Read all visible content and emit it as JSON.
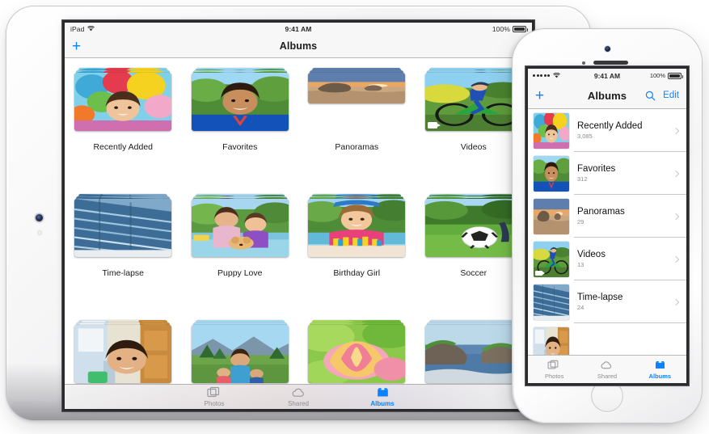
{
  "ipad": {
    "status": {
      "carrier": "iPad",
      "wifi_icon": "wifi-icon",
      "time": "9:41 AM",
      "battery": "100%"
    },
    "nav": {
      "add_label": "+",
      "title": "Albums"
    },
    "albums": [
      {
        "label": "Recently Added",
        "image": "girl-with-balloons"
      },
      {
        "label": "Favorites",
        "image": "boy-in-blue-shirt"
      },
      {
        "label": "Panoramas",
        "image": "sea-stack-panorama",
        "wide": true
      },
      {
        "label": "Videos",
        "image": "mountain-biker",
        "video": true
      },
      {
        "label": "Time-lapse",
        "image": "glass-building"
      },
      {
        "label": "Puppy Love",
        "image": "mother-daughter-puppy"
      },
      {
        "label": "Birthday Girl",
        "image": "girl-birthday-cake"
      },
      {
        "label": "Soccer",
        "image": "soccer-ball-grass"
      },
      {
        "label": "",
        "image": "girl-in-doorway"
      },
      {
        "label": "",
        "image": "family-mountains"
      },
      {
        "label": "",
        "image": "tulip-closeup"
      },
      {
        "label": "",
        "image": "coastal-cliffs"
      }
    ],
    "tabs": [
      {
        "label": "Photos",
        "icon": "photos-icon",
        "active": false
      },
      {
        "label": "Shared",
        "icon": "cloud-icon",
        "active": false
      },
      {
        "label": "Albums",
        "icon": "albums-icon",
        "active": true
      }
    ]
  },
  "iphone": {
    "status": {
      "signal": "•••••",
      "wifi_icon": "wifi-icon",
      "time": "9:41 AM",
      "battery": "100%"
    },
    "nav": {
      "add_label": "+",
      "title": "Albums",
      "search_icon": "search-icon",
      "edit_label": "Edit"
    },
    "rows": [
      {
        "name": "Recently Added",
        "count": "3,085",
        "image": "girl-with-balloons"
      },
      {
        "name": "Favorites",
        "count": "312",
        "image": "boy-in-blue-shirt"
      },
      {
        "name": "Panoramas",
        "count": "29",
        "image": "sea-stack-panorama"
      },
      {
        "name": "Videos",
        "count": "13",
        "image": "mountain-biker",
        "video": true
      },
      {
        "name": "Time-lapse",
        "count": "24",
        "image": "glass-building"
      },
      {
        "name": "",
        "count": "",
        "image": "girl-in-doorway"
      }
    ],
    "tabs": [
      {
        "label": "Photos",
        "icon": "photos-icon",
        "active": false
      },
      {
        "label": "Shared",
        "icon": "cloud-icon",
        "active": false
      },
      {
        "label": "Albums",
        "icon": "albums-icon",
        "active": true
      }
    ]
  },
  "colors": {
    "accent": "#0a82ff",
    "nav_bg": "#f7f7f7",
    "inactive": "#8e8e93",
    "separator": "#c8c7cc"
  }
}
